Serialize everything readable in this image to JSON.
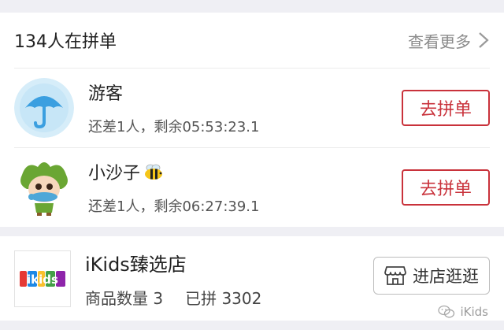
{
  "group": {
    "title": "134人在拼单",
    "see_more": "查看更多",
    "rows": [
      {
        "name": "游客",
        "status": "还差1人，剩余05:53:23.1",
        "button": "去拼单",
        "avatar": "umbrella-avatar-icon"
      },
      {
        "name": "小沙子",
        "status": "还差1人，剩余06:27:39.1",
        "button": "去拼单",
        "avatar": "cartoon-character-avatar",
        "badge": "bee-emoji-icon"
      }
    ]
  },
  "shop": {
    "name": "iKids臻选店",
    "product_count": "商品数量 3",
    "sold": "已拼 3302",
    "visit_button": "进店逛逛",
    "logo_text": "ikids"
  },
  "watermark": "iKids",
  "colors": {
    "accent": "#c9323b",
    "background": "#efeff4",
    "avatar_blue": "#3b9fe0"
  }
}
